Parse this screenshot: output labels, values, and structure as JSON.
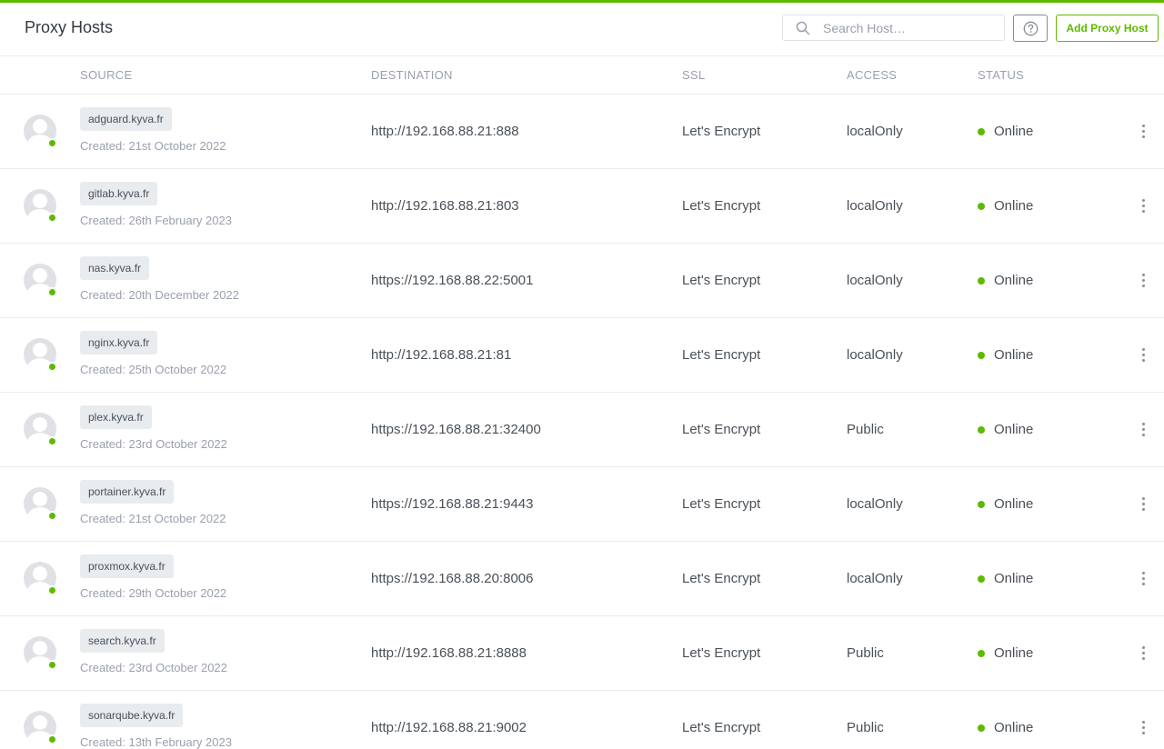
{
  "colors": {
    "accent": "#5eba00",
    "status_online": "#5eba00",
    "tag_bg": "#e9ecef",
    "muted_text": "#9aa0ac"
  },
  "header": {
    "title": "Proxy Hosts",
    "search": {
      "placeholder": "Search Host…",
      "value": "",
      "icon": "search-icon"
    },
    "help_icon": "question-circle-icon",
    "add_button": "Add Proxy Host"
  },
  "table": {
    "columns": [
      "SOURCE",
      "DESTINATION",
      "SSL",
      "ACCESS",
      "STATUS"
    ],
    "rows": [
      {
        "source": "adguard.kyva.fr",
        "created": "Created: 21st October 2022",
        "destination": "http://192.168.88.21:888",
        "ssl": "Let's Encrypt",
        "access": "localOnly",
        "status": "Online"
      },
      {
        "source": "gitlab.kyva.fr",
        "created": "Created: 26th February 2023",
        "destination": "http://192.168.88.21:803",
        "ssl": "Let's Encrypt",
        "access": "localOnly",
        "status": "Online"
      },
      {
        "source": "nas.kyva.fr",
        "created": "Created: 20th December 2022",
        "destination": "https://192.168.88.22:5001",
        "ssl": "Let's Encrypt",
        "access": "localOnly",
        "status": "Online"
      },
      {
        "source": "nginx.kyva.fr",
        "created": "Created: 25th October 2022",
        "destination": "http://192.168.88.21:81",
        "ssl": "Let's Encrypt",
        "access": "localOnly",
        "status": "Online"
      },
      {
        "source": "plex.kyva.fr",
        "created": "Created: 23rd October 2022",
        "destination": "https://192.168.88.21:32400",
        "ssl": "Let's Encrypt",
        "access": "Public",
        "status": "Online"
      },
      {
        "source": "portainer.kyva.fr",
        "created": "Created: 21st October 2022",
        "destination": "https://192.168.88.21:9443",
        "ssl": "Let's Encrypt",
        "access": "localOnly",
        "status": "Online"
      },
      {
        "source": "proxmox.kyva.fr",
        "created": "Created: 29th October 2022",
        "destination": "https://192.168.88.20:8006",
        "ssl": "Let's Encrypt",
        "access": "localOnly",
        "status": "Online"
      },
      {
        "source": "search.kyva.fr",
        "created": "Created: 23rd October 2022",
        "destination": "http://192.168.88.21:8888",
        "ssl": "Let's Encrypt",
        "access": "Public",
        "status": "Online"
      },
      {
        "source": "sonarqube.kyva.fr",
        "created": "Created: 13th February 2023",
        "destination": "http://192.168.88.21:9002",
        "ssl": "Let's Encrypt",
        "access": "Public",
        "status": "Online"
      }
    ]
  }
}
